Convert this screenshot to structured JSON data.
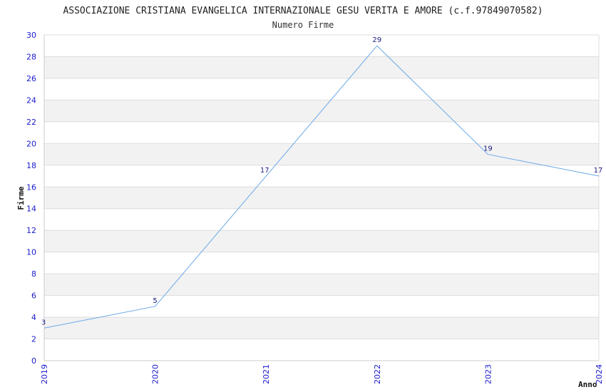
{
  "chart_data": {
    "type": "line",
    "title": "ASSOCIAZIONE CRISTIANA EVANGELICA INTERNAZIONALE GESU VERITA E AMORE (c.f.97849070582)",
    "subtitle": "Numero Firme",
    "xlabel": "Anno",
    "ylabel": "Firme",
    "categories": [
      "2019",
      "2020",
      "2021",
      "2022",
      "2023",
      "2024"
    ],
    "series": [
      {
        "values": [
          3,
          5,
          17,
          29,
          19,
          17
        ]
      }
    ],
    "ylim": [
      0,
      30
    ],
    "yticks": [
      0,
      2,
      4,
      6,
      8,
      10,
      12,
      14,
      16,
      18,
      20,
      22,
      24,
      26,
      28,
      30
    ],
    "grid": true,
    "line_color": "#6aa8e8",
    "band_color": "#f2f2f2",
    "tick_color": "#1a1acc"
  }
}
